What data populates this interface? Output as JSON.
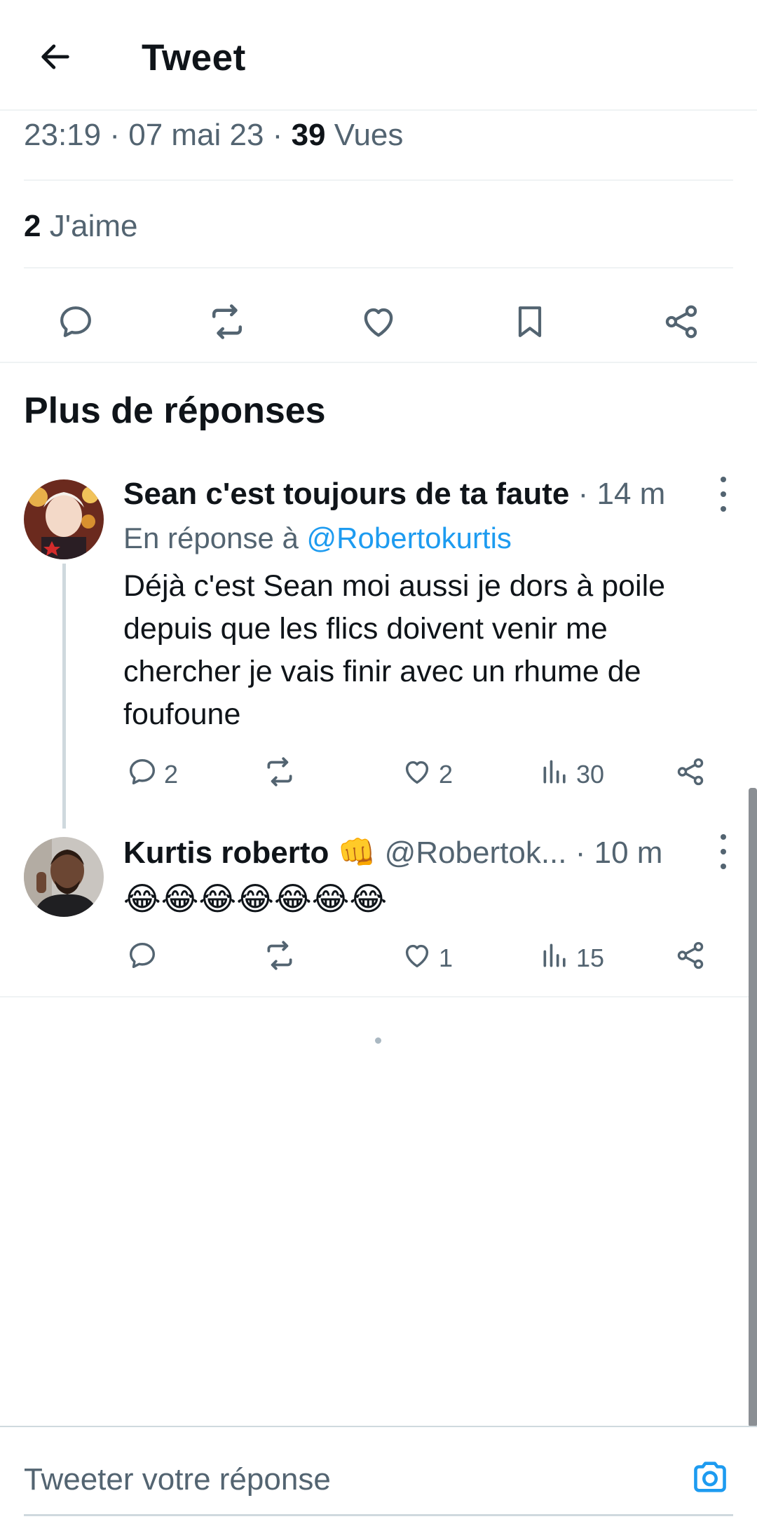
{
  "header": {
    "title": "Tweet"
  },
  "tweet_meta": {
    "time": "23:19",
    "date": "07 mai 23",
    "views_count": "39",
    "views_label": "Vues",
    "separator": " · "
  },
  "tweet_stats": {
    "likes_count": "2",
    "likes_label": "J'aime"
  },
  "section": {
    "title": "Plus de réponses"
  },
  "replies": [
    {
      "name": "Sean c'est toujours de ta faute",
      "time": "· 14 m",
      "reply_prefix": "En réponse à",
      "reply_handle": "@Robertokurtis",
      "text": "Déjà c'est Sean moi aussi je dors à poile depuis que les flics doivent venir me chercher je vais finir avec un rhume de foufoune",
      "replies": "2",
      "retweets": "",
      "likes": "2",
      "views": "30"
    },
    {
      "name": "Kurtis roberto",
      "emoji": "👊",
      "handle": "@Robertok...",
      "time": "· 10 m",
      "text": "😂😂😂😂😂😂😂",
      "replies": "",
      "retweets": "",
      "likes": "1",
      "views": "15"
    }
  ],
  "composer": {
    "placeholder": "Tweeter votre réponse"
  },
  "colors": {
    "accent": "#1d9bf0",
    "text": "#0f1419",
    "secondary": "#536471",
    "border": "#eff3f4"
  }
}
